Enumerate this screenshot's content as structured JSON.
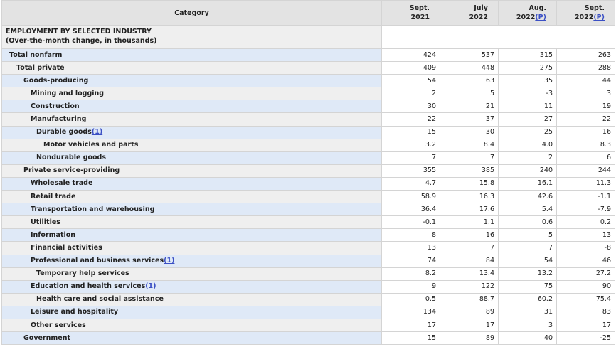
{
  "columns": {
    "category": "Category",
    "c1": {
      "line1": "Sept.",
      "line2": "2021",
      "suffix": ""
    },
    "c2": {
      "line1": "July",
      "line2": "2022",
      "suffix": ""
    },
    "c3": {
      "line1": "Aug.",
      "line2": "2022",
      "suffix": "(P)"
    },
    "c4": {
      "line1": "Sept.",
      "line2": "2022",
      "suffix": "(P)"
    }
  },
  "section": {
    "title": "EMPLOYMENT BY SELECTED INDUSTRY",
    "subtitle": "(Over-the-month change, in thousands)"
  },
  "rows": [
    {
      "label": "Total nonfarm",
      "footnote": "",
      "level": 0,
      "values": [
        "424",
        "537",
        "315",
        "263"
      ]
    },
    {
      "label": "Total private",
      "footnote": "",
      "level": 1,
      "values": [
        "409",
        "448",
        "275",
        "288"
      ]
    },
    {
      "label": "Goods-producing",
      "footnote": "",
      "level": 2,
      "values": [
        "54",
        "63",
        "35",
        "44"
      ]
    },
    {
      "label": "Mining and logging",
      "footnote": "",
      "level": 3,
      "values": [
        "2",
        "5",
        "-3",
        "3"
      ]
    },
    {
      "label": "Construction",
      "footnote": "",
      "level": 3,
      "values": [
        "30",
        "21",
        "11",
        "19"
      ]
    },
    {
      "label": "Manufacturing",
      "footnote": "",
      "level": 3,
      "values": [
        "22",
        "37",
        "27",
        "22"
      ]
    },
    {
      "label": "Durable goods",
      "footnote": "(1)",
      "level": 4,
      "values": [
        "15",
        "30",
        "25",
        "16"
      ]
    },
    {
      "label": "Motor vehicles and parts",
      "footnote": "",
      "level": 5,
      "values": [
        "3.2",
        "8.4",
        "4.0",
        "8.3"
      ]
    },
    {
      "label": "Nondurable goods",
      "footnote": "",
      "level": 4,
      "values": [
        "7",
        "7",
        "2",
        "6"
      ]
    },
    {
      "label": "Private service-providing",
      "footnote": "",
      "level": 2,
      "values": [
        "355",
        "385",
        "240",
        "244"
      ]
    },
    {
      "label": "Wholesale trade",
      "footnote": "",
      "level": 3,
      "values": [
        "4.7",
        "15.8",
        "16.1",
        "11.3"
      ]
    },
    {
      "label": "Retail trade",
      "footnote": "",
      "level": 3,
      "values": [
        "58.9",
        "16.3",
        "42.6",
        "-1.1"
      ]
    },
    {
      "label": "Transportation and warehousing",
      "footnote": "",
      "level": 3,
      "values": [
        "36.4",
        "17.6",
        "5.4",
        "-7.9"
      ]
    },
    {
      "label": "Utilities",
      "footnote": "",
      "level": 3,
      "values": [
        "-0.1",
        "1.1",
        "0.6",
        "0.2"
      ]
    },
    {
      "label": "Information",
      "footnote": "",
      "level": 3,
      "values": [
        "8",
        "16",
        "5",
        "13"
      ]
    },
    {
      "label": "Financial activities",
      "footnote": "",
      "level": 3,
      "values": [
        "13",
        "7",
        "7",
        "-8"
      ]
    },
    {
      "label": "Professional and business services",
      "footnote": "(1)",
      "level": 3,
      "values": [
        "74",
        "84",
        "54",
        "46"
      ]
    },
    {
      "label": "Temporary help services",
      "footnote": "",
      "level": 4,
      "values": [
        "8.2",
        "13.4",
        "13.2",
        "27.2"
      ]
    },
    {
      "label": "Education and health services",
      "footnote": "(1)",
      "level": 3,
      "values": [
        "9",
        "122",
        "75",
        "90"
      ]
    },
    {
      "label": "Health care and social assistance",
      "footnote": "",
      "level": 4,
      "values": [
        "0.5",
        "88.7",
        "60.2",
        "75.4"
      ]
    },
    {
      "label": "Leisure and hospitality",
      "footnote": "",
      "level": 3,
      "values": [
        "134",
        "89",
        "31",
        "83"
      ]
    },
    {
      "label": "Other services",
      "footnote": "",
      "level": 3,
      "values": [
        "17",
        "17",
        "3",
        "17"
      ]
    },
    {
      "label": "Government",
      "footnote": "",
      "level": 2,
      "values": [
        "15",
        "89",
        "40",
        "-25"
      ]
    }
  ]
}
